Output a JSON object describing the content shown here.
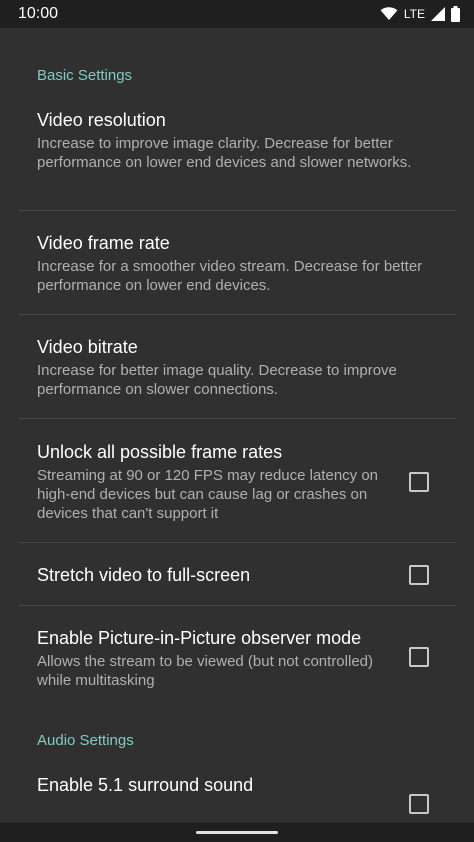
{
  "status_bar": {
    "time": "10:00",
    "network": "LTE",
    "icons": [
      "wifi-icon",
      "signal-icon",
      "battery-icon"
    ]
  },
  "sections": [
    {
      "header": "Basic Settings",
      "items": [
        {
          "title": "Video resolution",
          "summary": "Increase to improve image clarity. Decrease for better performance on lower end devices and slower networks.",
          "checkbox": null
        },
        {
          "title": "Video frame rate",
          "summary": "Increase for a smoother video stream. Decrease for better performance on lower end devices.",
          "checkbox": null
        },
        {
          "title": "Video bitrate",
          "summary": "Increase for better image quality. Decrease to improve performance on slower connections.",
          "checkbox": null
        },
        {
          "title": "Unlock all possible frame rates",
          "summary": "Streaming at 90 or 120 FPS may reduce latency on high-end devices but can cause lag or crashes on devices that can't support it",
          "checkbox": false
        },
        {
          "title": "Stretch video to full-screen",
          "summary": "",
          "checkbox": false
        },
        {
          "title": "Enable Picture-in-Picture observer mode",
          "summary": "Allows the stream to be viewed (but not controlled) while multitasking",
          "checkbox": false
        }
      ]
    },
    {
      "header": "Audio Settings",
      "items": [
        {
          "title": "Enable 5.1 surround sound",
          "summary": "",
          "checkbox": false
        }
      ]
    }
  ],
  "colors": {
    "background": "#303030",
    "accent": "#80cbc4",
    "summary_text": "#b0b0b0",
    "divider": "#474747"
  }
}
